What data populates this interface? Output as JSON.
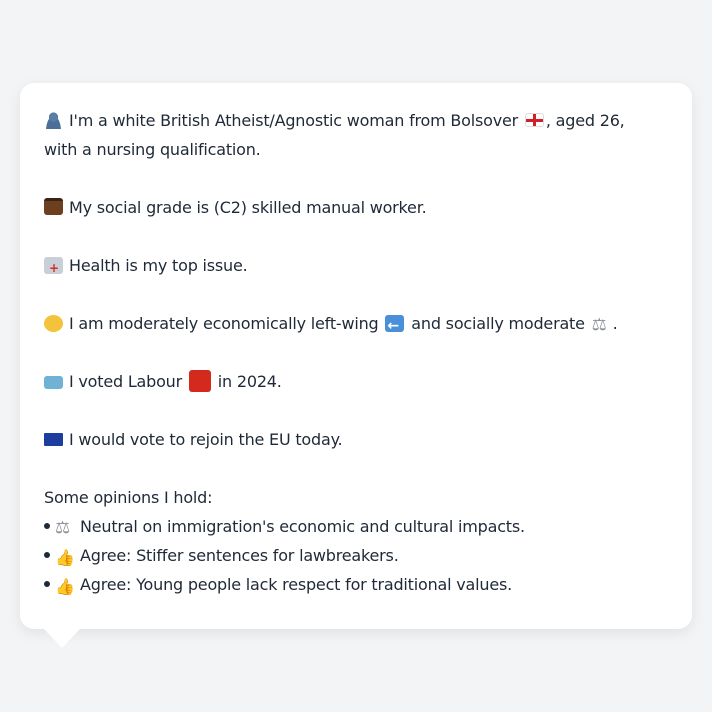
{
  "profile": {
    "line1_a": "I'm a white British Atheist/Agnostic woman from Bolsover",
    "line1_b": ", aged 26,",
    "line2": "with a nursing qualification.",
    "social_grade": "My social grade is (C2) skilled manual worker.",
    "top_issue": "Health is my top issue.",
    "ideology_a": "I am moderately economically left-wing",
    "ideology_b": "and socially moderate",
    "ideology_c": ".",
    "vote_a": "I voted Labour",
    "vote_b": "in 2024.",
    "eu": "I would vote to rejoin the EU today.",
    "opinions_heading": "Some opinions I hold:",
    "opinions": [
      {
        "icon": "balance-scale-icon",
        "text": "Neutral on immigration's economic and cultural impacts."
      },
      {
        "icon": "thumbs-up-icon",
        "text": "Agree: Stiffer sentences for lawbreakers."
      },
      {
        "icon": "thumbs-up-icon",
        "text": "Agree: Young people lack respect for traditional values."
      }
    ]
  },
  "colors": {
    "background": "#f3f4f6",
    "card": "#ffffff",
    "text": "#1f2937",
    "labour_red": "#d42a1e"
  }
}
